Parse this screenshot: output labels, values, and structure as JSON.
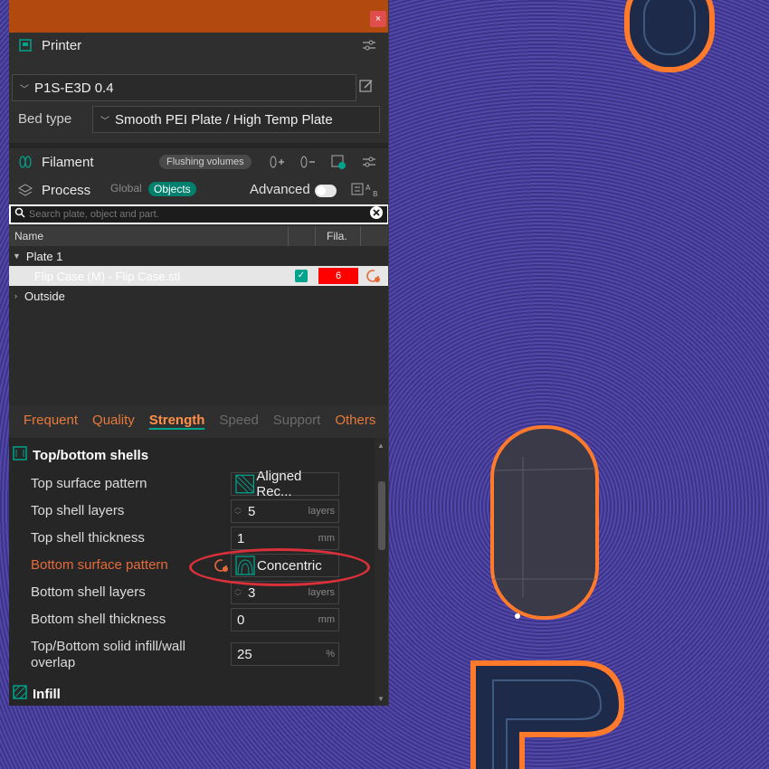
{
  "window": {
    "close_label": "×"
  },
  "printer": {
    "title": "Printer",
    "preset": "P1S-E3D 0.4",
    "bed_type_label": "Bed type",
    "bed_type_value": "Smooth PEI Plate / High Temp Plate"
  },
  "filament": {
    "title": "Filament",
    "flushing_label": "Flushing volumes"
  },
  "process": {
    "title": "Process",
    "mode_global": "Global",
    "mode_objects": "Objects",
    "advanced_label": "Advanced"
  },
  "search": {
    "placeholder": "Search plate, object and part."
  },
  "tree": {
    "columns": [
      "Name",
      "Fila."
    ],
    "plate": "Plate 1",
    "object": "Flip Case (M) - Flip Case.stl",
    "object_filament": "6",
    "outside": "Outside"
  },
  "tabs": [
    {
      "label": "Frequent",
      "state": "normal"
    },
    {
      "label": "Quality",
      "state": "normal"
    },
    {
      "label": "Strength",
      "state": "active"
    },
    {
      "label": "Speed",
      "state": "disabled"
    },
    {
      "label": "Support",
      "state": "disabled"
    },
    {
      "label": "Others",
      "state": "normal"
    }
  ],
  "settings": {
    "group_top_bottom": "Top/bottom shells",
    "group_infill": "Infill",
    "rows": [
      {
        "label": "Top surface pattern",
        "value": "Aligned Rec...",
        "unit": ""
      },
      {
        "label": "Top shell layers",
        "value": "5",
        "unit": "layers"
      },
      {
        "label": "Top shell thickness",
        "value": "1",
        "unit": "mm"
      },
      {
        "label": "Bottom surface pattern",
        "value": "Concentric",
        "unit": ""
      },
      {
        "label": "Bottom shell layers",
        "value": "3",
        "unit": "layers"
      },
      {
        "label": "Bottom shell thickness",
        "value": "0",
        "unit": "mm"
      },
      {
        "label": "Top/Bottom solid infill/wall overlap",
        "value": "25",
        "unit": "%"
      }
    ]
  },
  "colors": {
    "accent": "#00a38b",
    "tab_orange": "#e67a3c",
    "filament_red": "#ff0000",
    "title_bar": "#b24a10"
  }
}
